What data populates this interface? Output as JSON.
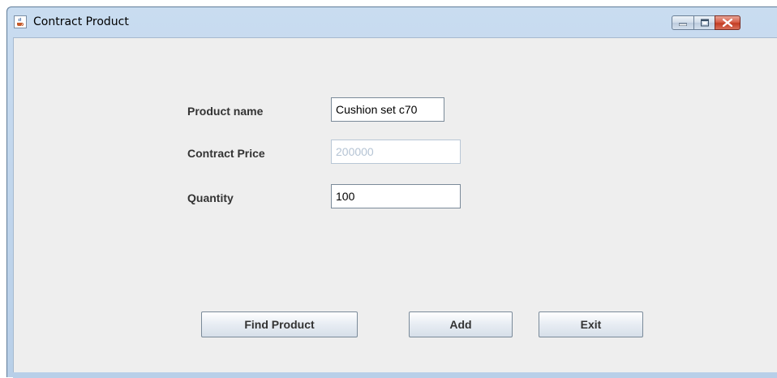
{
  "window": {
    "title": "Contract Product",
    "icon": "java-cup-icon",
    "controls": [
      "minimize-icon",
      "maximize-icon",
      "close-icon"
    ]
  },
  "form": {
    "product_name_label": "Product name",
    "product_name_value": "Cushion set c70",
    "contract_price_label": "Contract Price",
    "contract_price_value": "200000",
    "quantity_label": "Quantity",
    "quantity_value": "100"
  },
  "buttons": {
    "find_product": "Find Product",
    "add": "Add",
    "exit": "Exit"
  },
  "colors": {
    "title_bar": "#c9dcf0",
    "content_bg": "#eeeeee",
    "label_text": "#333333",
    "disabled_text": "#b5c4d4",
    "close_button": "#c33d24"
  }
}
